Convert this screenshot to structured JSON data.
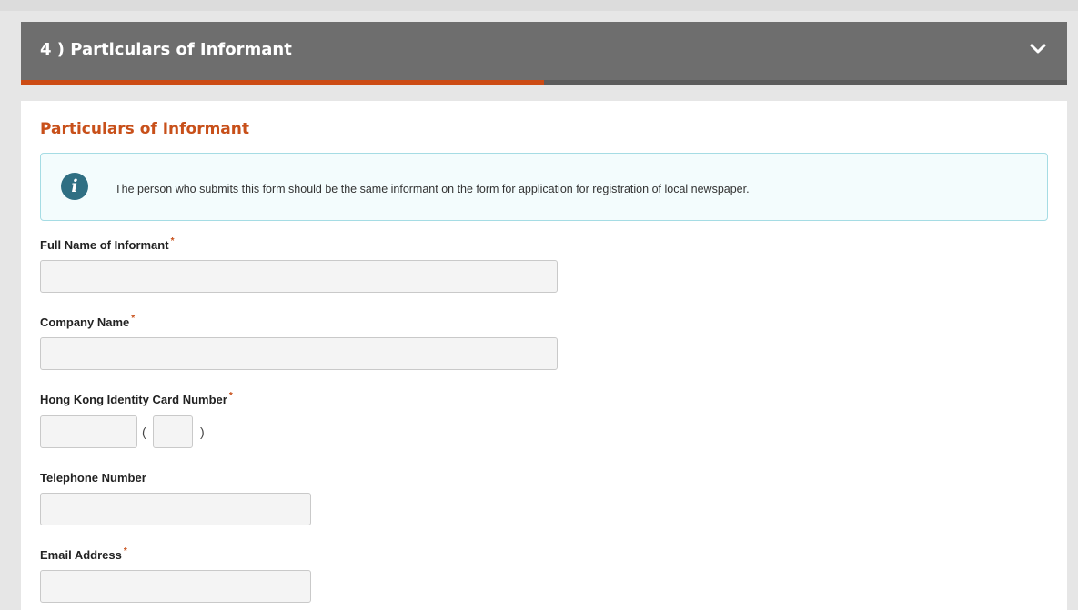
{
  "accordion": {
    "title": "4 ) Particulars of Informant",
    "progress_fraction": 0.5
  },
  "section": {
    "title": "Particulars of Informant",
    "info_text": "The person who submits this form should be the same informant on the form for application for registration of local newspaper."
  },
  "fields": {
    "full_name": {
      "label": "Full Name of Informant",
      "required_mark": "*",
      "value": ""
    },
    "company_name": {
      "label": "Company Name",
      "required_mark": "*",
      "value": ""
    },
    "hkid": {
      "label": "Hong Kong Identity Card Number",
      "required_mark": "*",
      "main_value": "",
      "check_digit_value": "",
      "open_paren": "(",
      "close_paren": ")"
    },
    "telephone": {
      "label": "Telephone Number",
      "value": ""
    },
    "email": {
      "label": "Email Address",
      "required_mark": "*",
      "value": ""
    }
  },
  "colors": {
    "header_bg": "#6e6e6e",
    "accent": "#c8501a",
    "info_bg": "#f3fcfd",
    "info_border": "#a5dce4",
    "info_icon": "#2f6f83"
  },
  "icons": {
    "header_toggle": "chevron-down-icon",
    "info": "info-icon"
  }
}
